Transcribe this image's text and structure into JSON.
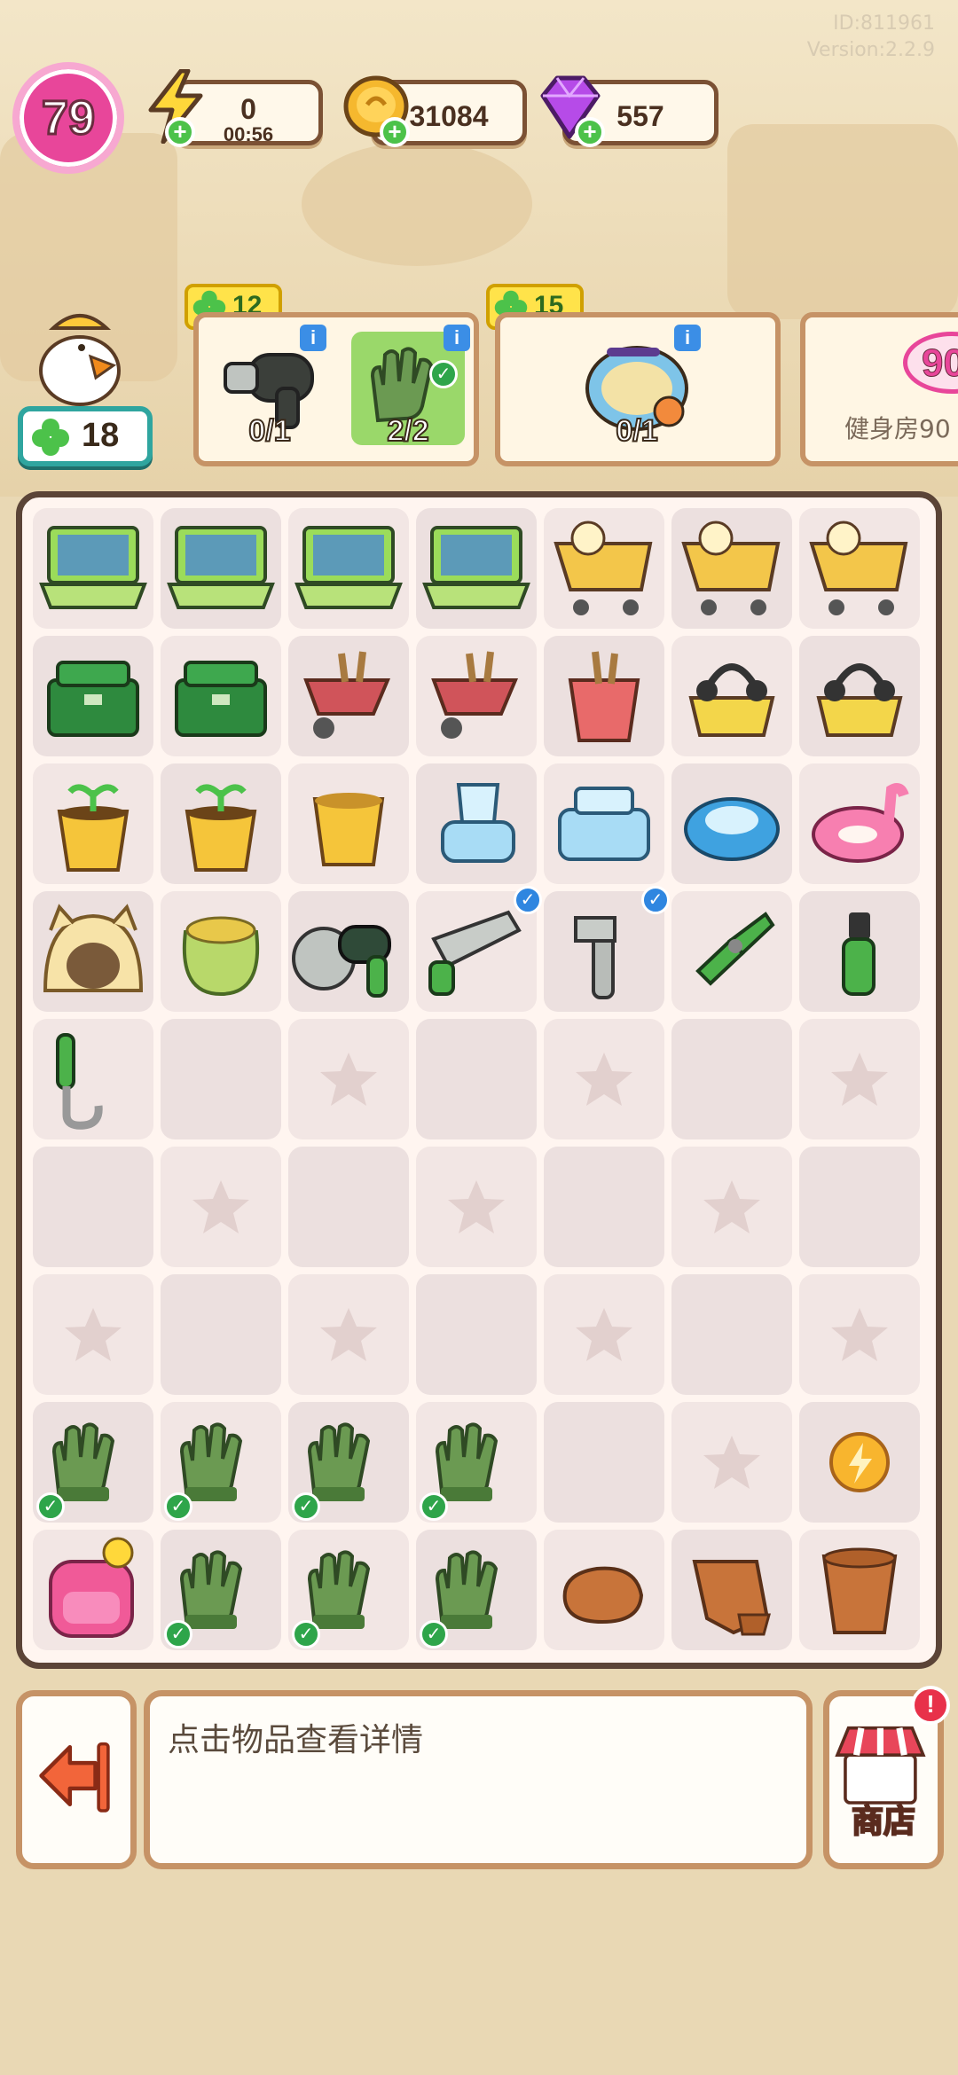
{
  "build": {
    "id": "ID:811961",
    "version": "Version:2.2.9"
  },
  "player": {
    "level": "79"
  },
  "resources": {
    "energy": {
      "value": "0",
      "timer": "00:56"
    },
    "coins": {
      "value": "31084"
    },
    "gems": {
      "value": "557"
    }
  },
  "clover_count": "18",
  "orders": [
    {
      "reward": "12",
      "items": [
        {
          "name": "hair-dryer",
          "count": "0/1"
        },
        {
          "name": "work-glove",
          "count": "2/2"
        }
      ]
    },
    {
      "reward": "15",
      "items": [
        {
          "name": "gym-fat-goose-logo",
          "count": "0/1"
        }
      ]
    },
    {
      "badge": "90",
      "label": "健身房90"
    }
  ],
  "board": {
    "cells": [
      "laptop",
      "laptop",
      "laptop",
      "laptop",
      "shopping-cart",
      "shopping-cart",
      "shopping-cart",
      "toolbox",
      "toolbox",
      "wheelbarrow",
      "wheelbarrow",
      "tool-bucket",
      "headphone-cart",
      "headphone-cart",
      "sprout-pot",
      "sprout-pot",
      "empty-pot",
      "blender",
      "printer",
      "robot-vacuum",
      "flamingo-float",
      "cat-bed",
      "seed-sack",
      "angle-grinder",
      "hacksaw",
      "wrench",
      "pliers",
      "screwdriver",
      "hook",
      "empty",
      "star",
      "empty",
      "star",
      "empty",
      "star",
      "empty",
      "star",
      "empty",
      "star",
      "empty",
      "star",
      "empty",
      "star",
      "empty",
      "star",
      "empty",
      "star",
      "empty",
      "star",
      "work-glove",
      "work-glove",
      "work-glove",
      "work-glove",
      "empty",
      "star",
      "energy-coin",
      "backpack",
      "work-glove",
      "work-glove",
      "work-glove",
      "clay-lump",
      "clay-shard",
      "clay-pot"
    ]
  },
  "detail_text": "点击物品查看详情",
  "shop_label": "商店",
  "colors": {
    "board_border": "#5b4437",
    "panel_border": "#c69366",
    "clover_green": "#4cc24a",
    "level_pink": "#e8469a"
  }
}
